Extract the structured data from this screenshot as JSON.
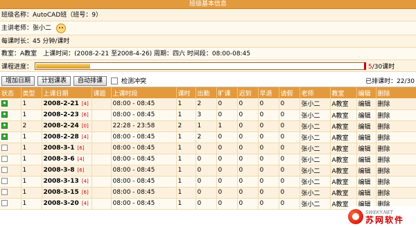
{
  "window": {
    "title": "班级基本信息"
  },
  "class_info": {
    "name_line": "班级名称：AutoCAD班（班号：9）",
    "teacher_line": "主讲老师：张小二",
    "duration_line": "每课时长：45 分钟/课时",
    "schedule_line": "教室：A教室　上课时间：(2008-2-21 至2008-4-26) 周期：四六 时间段：08:00-08:45"
  },
  "progress": {
    "label": "课程进度：",
    "value": 0.167,
    "done": "5",
    "rest": "/30课时"
  },
  "toolbar": {
    "add_date_label": "增加日期",
    "plan_table_label": "计划课表",
    "auto_schedule_label": "自动排课",
    "detect_conflict_label": "检测冲突",
    "scheduled_label": "已排课时：22/30"
  },
  "table": {
    "headers": [
      "状态",
      "类型",
      "上课日期",
      "课题",
      "上课时段",
      "课时",
      "出勤",
      "旷课",
      "迟到",
      "早退",
      "请假",
      "老师",
      "教室",
      "编辑",
      "删除"
    ],
    "rows": [
      {
        "status": "on",
        "type": "1",
        "date": "2008-2-21",
        "tag": "[4]",
        "topic": "",
        "time": "08:00 - 08:45",
        "hours": "1",
        "present": "2",
        "absent": "0",
        "late": "0",
        "early": "0",
        "leave": "0",
        "teacher": "张小二",
        "room": "A教室",
        "edit": "编辑",
        "del": "删除"
      },
      {
        "status": "on",
        "type": "1",
        "date": "2008-2-23",
        "tag": "[6]",
        "topic": "",
        "time": "08:00 - 08:45",
        "hours": "1",
        "present": "3",
        "absent": "0",
        "late": "0",
        "early": "0",
        "leave": "0",
        "teacher": "张小二",
        "room": "A教室",
        "edit": "编辑",
        "del": "删除"
      },
      {
        "status": "on",
        "type": "2",
        "date": "2008-2-24",
        "tag": "[0]",
        "topic": "",
        "time": "22:28 - 23:58",
        "hours": "2",
        "present": "1",
        "absent": "1",
        "late": "0",
        "early": "0",
        "leave": "0",
        "teacher": "张小二",
        "room": "A教室",
        "edit": "编辑",
        "del": "删除"
      },
      {
        "status": "on",
        "type": "1",
        "date": "2008-2-28",
        "tag": "[4]",
        "topic": "",
        "time": "08:00 - 08:45",
        "hours": "1",
        "present": "2",
        "absent": "0",
        "late": "0",
        "early": "0",
        "leave": "0",
        "teacher": "张小二",
        "room": "A教室",
        "edit": "编辑",
        "del": "删除"
      },
      {
        "status": "off",
        "type": "1",
        "date": "2008-3-1",
        "tag": "[6]",
        "topic": "",
        "time": "08:00 - 08:45",
        "hours": "1",
        "present": "0",
        "absent": "0",
        "late": "0",
        "early": "0",
        "leave": "0",
        "teacher": "张小二",
        "room": "A教室",
        "edit": "编辑",
        "del": "删除"
      },
      {
        "status": "off",
        "type": "1",
        "date": "2008-3-6",
        "tag": "[4]",
        "topic": "",
        "time": "08:00 - 08:45",
        "hours": "1",
        "present": "0",
        "absent": "0",
        "late": "0",
        "early": "0",
        "leave": "0",
        "teacher": "张小二",
        "room": "A教室",
        "edit": "编辑",
        "del": "删除"
      },
      {
        "status": "off",
        "type": "1",
        "date": "2008-3-8",
        "tag": "[6]",
        "topic": "",
        "time": "08:00 - 08:45",
        "hours": "1",
        "present": "0",
        "absent": "0",
        "late": "0",
        "early": "0",
        "leave": "0",
        "teacher": "张小二",
        "room": "A教室",
        "edit": "编辑",
        "del": "删除"
      },
      {
        "status": "off",
        "type": "1",
        "date": "2008-3-13",
        "tag": "[4]",
        "topic": "",
        "time": "08:00 - 08:45",
        "hours": "1",
        "present": "0",
        "absent": "0",
        "late": "0",
        "early": "0",
        "leave": "0",
        "teacher": "张小二",
        "room": "A教室",
        "edit": "编辑",
        "del": "删除"
      },
      {
        "status": "off",
        "type": "1",
        "date": "2008-3-15",
        "tag": "[6]",
        "topic": "",
        "time": "08:00 - 08:45",
        "hours": "1",
        "present": "0",
        "absent": "0",
        "late": "0",
        "early": "0",
        "leave": "0",
        "teacher": "张小二",
        "room": "A教室",
        "edit": "编辑",
        "del": "删除"
      },
      {
        "status": "off",
        "type": "1",
        "date": "2008-3-20",
        "tag": "[4]",
        "topic": "",
        "time": "08:00 - 08:45",
        "hours": "1",
        "present": "0",
        "absent": "0",
        "late": "0",
        "early": "0",
        "leave": "0",
        "teacher": "张小二",
        "room": "A教室",
        "edit": "编辑",
        "del": "删除"
      }
    ]
  },
  "watermark": {
    "url": "SWEKY.NET",
    "name": "苏网软件"
  },
  "colors": {
    "header": "#e39a3c",
    "row_odd": "#fdf1de",
    "row_even": "#fffaf0",
    "tag": "#cc0000",
    "status_on": "#3aa43a"
  },
  "icons": {
    "teacher": "smiley-icon",
    "status_on": "user-present-icon",
    "status_off": "checkbox-empty-icon"
  }
}
